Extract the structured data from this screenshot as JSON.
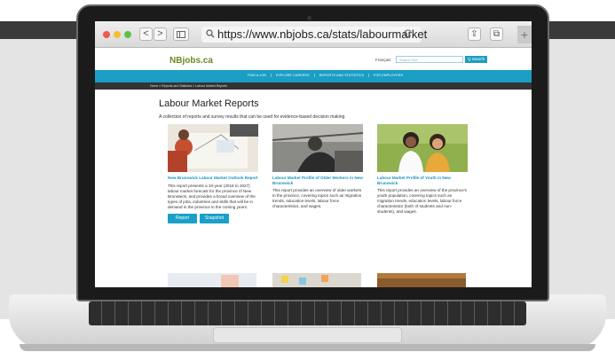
{
  "browser": {
    "url": "https://www.nbjobs.ca/stats/labourmarket",
    "back_glyph": "<",
    "forward_glyph": ">",
    "reload_glyph": "C",
    "share_glyph": "⇪",
    "tabs_glyph": "⧉",
    "new_tab_glyph": "+"
  },
  "site": {
    "logo": "NBjobs.ca",
    "language_link": "Français",
    "search_placeholder": "Search Site",
    "search_button": "Q Search",
    "nav": [
      "FIND A JOB",
      "EXPLORE CAREERS",
      "REPORTS AND STATISTICS",
      "FOR EMPLOYERS"
    ],
    "breadcrumb": "Home  »  Reports and Statistics  »  Labour Market Reports"
  },
  "page": {
    "title": "Labour Market Reports",
    "subtitle": "A collection of reports and survey results that can be used for evidence-based decision making."
  },
  "cards": [
    {
      "title": "New Brunswick Labour Market Outlook Report",
      "text": "This report presents a 10-year (2018 to 2027) labour market forecast for the province of New Brunswick, and provides a broad overview of the types of jobs, industries and skills that will be in demand in the province in the coming years.",
      "buttons": [
        "Report",
        "Snapshot"
      ]
    },
    {
      "title": "Labour Market Profile of Older Workers in New Brunswick",
      "text": "This report provides an overview of older workers in the province, covering topics such as migration trends, education levels, labour force characteristics, and wages."
    },
    {
      "title": "Labour Market Profile of Youth in New Brunswick",
      "text": "This report provides an overview of the province's youth population, covering topics such as migration trends, education levels, labour force characteristics (both of students and non-students), and wages."
    }
  ],
  "colors": {
    "accent": "#1a9ec4",
    "logo_green": "#6a8a1f",
    "link": "#1a92bd"
  }
}
